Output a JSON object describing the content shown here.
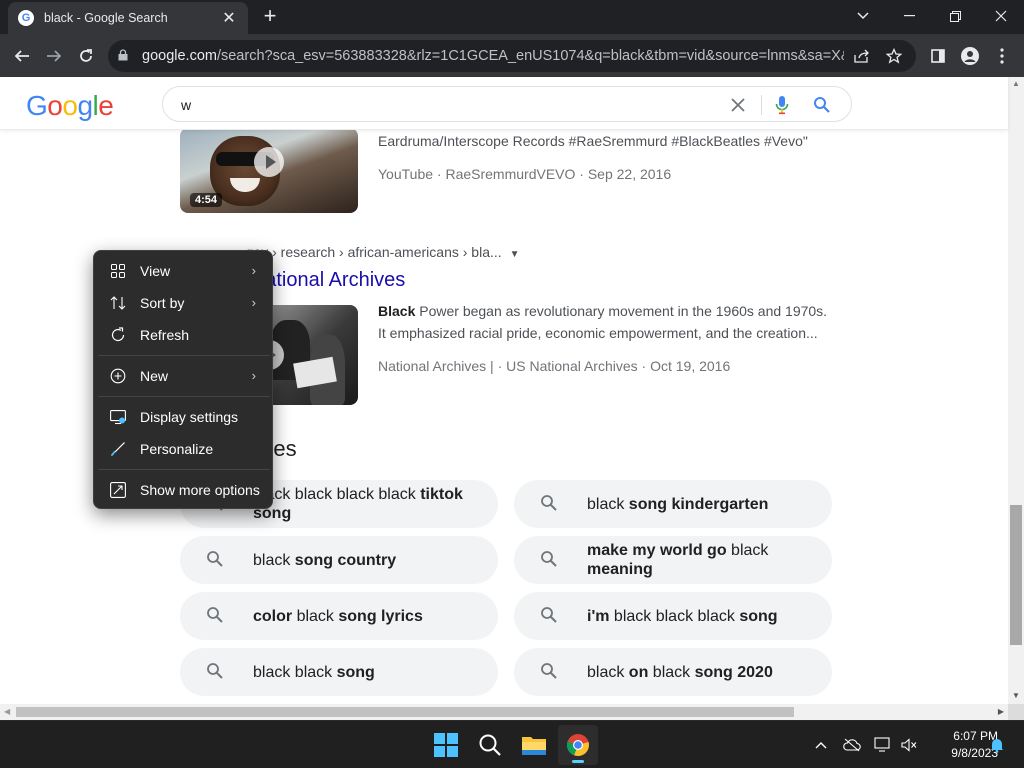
{
  "browser": {
    "tab": {
      "title": "black - Google Search",
      "favicon_letter": "G"
    },
    "url": {
      "host": "google.com",
      "path": "/search?sca_esv=563883328&rlz=1C1GCEA_enUS1074&q=black&tbm=vid&source=lnms&sa=X&ve..."
    }
  },
  "google": {
    "logo": {
      "l1": "G",
      "l2": "o",
      "l3": "o",
      "l4": "g",
      "l5": "l",
      "l6": "e"
    },
    "search": {
      "query": "w"
    }
  },
  "results": [
    {
      "snippet": "Eardruma/Interscope Records #RaeSremmurd #BlackBeatles #Vevo\"",
      "meta": "YouTube · RaeSremmurdVEVO · Sep 22, 2016",
      "duration": "4:54"
    },
    {
      "breadcrumb": "https://www.archives.gov › research › african-americans › bla...",
      "breadcrumb_visible": "...gov › research › african-americans › bla...",
      "title": "...er | National Archives",
      "snippet_bold": "Black",
      "snippet_line1": " Power began as revolutionary movement in the 1960s and 1970s.",
      "snippet_line2": "It emphasized racial pride, economic empowerment, and the creation...",
      "meta": "National Archives | · US National Archives · Oct 19, 2016"
    }
  ],
  "related": {
    "heading": "...earches",
    "chips": [
      {
        "parts": [
          [
            "black black black black ",
            false
          ],
          [
            "tiktok",
            true
          ],
          [
            " ",
            false
          ],
          [
            "song",
            true
          ]
        ]
      },
      {
        "parts": [
          [
            "black ",
            false
          ],
          [
            "song kindergarten",
            true
          ]
        ]
      },
      {
        "parts": [
          [
            "black ",
            false
          ],
          [
            "song country",
            true
          ]
        ]
      },
      {
        "parts": [
          [
            "make my world go",
            true
          ],
          [
            " black ",
            false
          ],
          [
            "meaning",
            true
          ]
        ]
      },
      {
        "parts": [
          [
            "color",
            true
          ],
          [
            " black ",
            false
          ],
          [
            "song lyrics",
            true
          ]
        ]
      },
      {
        "parts": [
          [
            "i'm",
            true
          ],
          [
            " black black black ",
            false
          ],
          [
            "song",
            true
          ]
        ]
      },
      {
        "parts": [
          [
            "black black ",
            false
          ],
          [
            "song",
            true
          ]
        ]
      },
      {
        "parts": [
          [
            "black ",
            false
          ],
          [
            "on",
            true
          ],
          [
            " black ",
            false
          ],
          [
            "song 2020",
            true
          ]
        ]
      }
    ]
  },
  "context_menu": {
    "items": [
      {
        "label": "View",
        "icon": "grid-icon",
        "submenu": true
      },
      {
        "label": "Sort by",
        "icon": "sort-icon",
        "submenu": true
      },
      {
        "label": "Refresh",
        "icon": "refresh-icon",
        "submenu": false
      },
      {
        "label": "New",
        "icon": "plus-circle-icon",
        "submenu": true
      },
      {
        "label": "Display settings",
        "icon": "display-icon",
        "submenu": false
      },
      {
        "label": "Personalize",
        "icon": "brush-icon",
        "submenu": false
      },
      {
        "label": "Show more options",
        "icon": "expand-icon",
        "submenu": false
      }
    ]
  },
  "taskbar": {
    "time": "6:07 PM",
    "date": "9/8/2023"
  },
  "colors": {
    "link": "#1a0dab",
    "menu_bg": "#2c2c2c",
    "chip_bg": "#f1f3f4",
    "taskbar_bg": "#202020"
  }
}
